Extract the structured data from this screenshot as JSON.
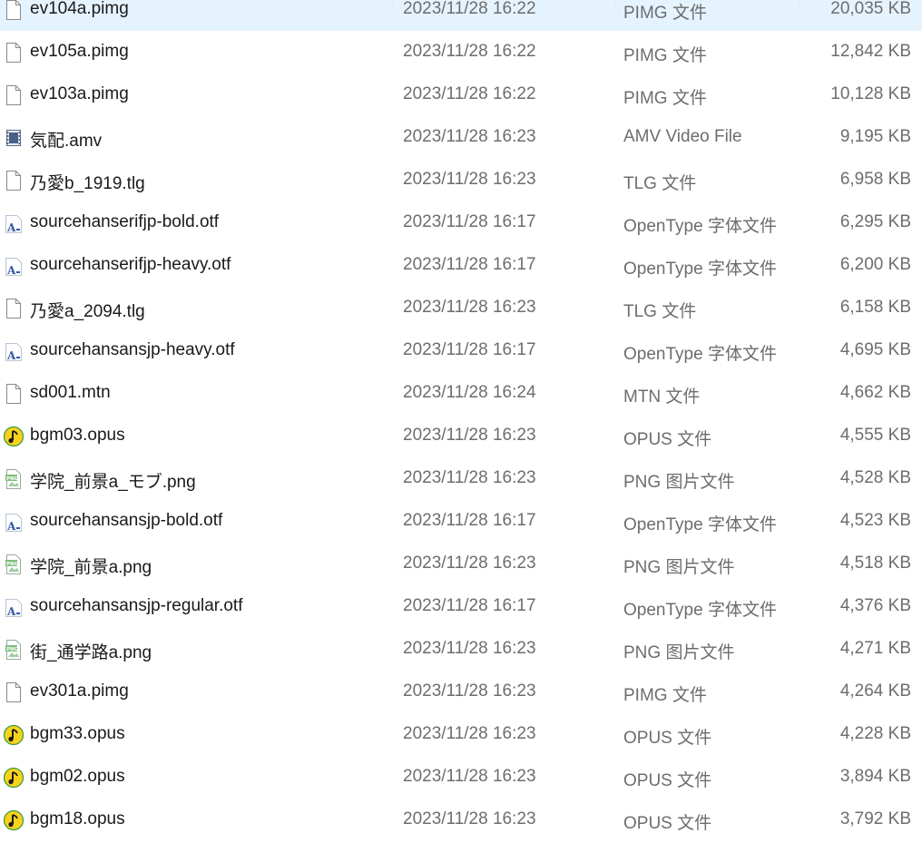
{
  "files": [
    {
      "name": "ev104a.pimg",
      "date": "2023/11/28 16:22",
      "type": "PIMG 文件",
      "size": "20,035 KB",
      "icon": "blank-file-icon"
    },
    {
      "name": "ev105a.pimg",
      "date": "2023/11/28 16:22",
      "type": "PIMG 文件",
      "size": "12,842 KB",
      "icon": "blank-file-icon"
    },
    {
      "name": "ev103a.pimg",
      "date": "2023/11/28 16:22",
      "type": "PIMG 文件",
      "size": "10,128 KB",
      "icon": "blank-file-icon"
    },
    {
      "name": "気配.amv",
      "date": "2023/11/28 16:23",
      "type": "AMV Video File",
      "size": "9,195 KB",
      "icon": "video-file-icon"
    },
    {
      "name": "乃愛b_1919.tlg",
      "date": "2023/11/28 16:23",
      "type": "TLG 文件",
      "size": "6,958 KB",
      "icon": "blank-file-icon"
    },
    {
      "name": "sourcehanserifjp-bold.otf",
      "date": "2023/11/28 16:17",
      "type": "OpenType 字体文件",
      "size": "6,295 KB",
      "icon": "font-file-icon"
    },
    {
      "name": "sourcehanserifjp-heavy.otf",
      "date": "2023/11/28 16:17",
      "type": "OpenType 字体文件",
      "size": "6,200 KB",
      "icon": "font-file-icon"
    },
    {
      "name": "乃愛a_2094.tlg",
      "date": "2023/11/28 16:23",
      "type": "TLG 文件",
      "size": "6,158 KB",
      "icon": "blank-file-icon"
    },
    {
      "name": "sourcehansansjp-heavy.otf",
      "date": "2023/11/28 16:17",
      "type": "OpenType 字体文件",
      "size": "4,695 KB",
      "icon": "font-file-icon"
    },
    {
      "name": "sd001.mtn",
      "date": "2023/11/28 16:24",
      "type": "MTN 文件",
      "size": "4,662 KB",
      "icon": "blank-file-icon"
    },
    {
      "name": "bgm03.opus",
      "date": "2023/11/28 16:23",
      "type": "OPUS 文件",
      "size": "4,555 KB",
      "icon": "music-file-icon"
    },
    {
      "name": "学院_前景a_モブ.png",
      "date": "2023/11/28 16:23",
      "type": "PNG 图片文件",
      "size": "4,528 KB",
      "icon": "image-file-icon"
    },
    {
      "name": "sourcehansansjp-bold.otf",
      "date": "2023/11/28 16:17",
      "type": "OpenType 字体文件",
      "size": "4,523 KB",
      "icon": "font-file-icon"
    },
    {
      "name": "学院_前景a.png",
      "date": "2023/11/28 16:23",
      "type": "PNG 图片文件",
      "size": "4,518 KB",
      "icon": "image-file-icon"
    },
    {
      "name": "sourcehansansjp-regular.otf",
      "date": "2023/11/28 16:17",
      "type": "OpenType 字体文件",
      "size": "4,376 KB",
      "icon": "font-file-icon"
    },
    {
      "name": "街_通学路a.png",
      "date": "2023/11/28 16:23",
      "type": "PNG 图片文件",
      "size": "4,271 KB",
      "icon": "image-file-icon"
    },
    {
      "name": "ev301a.pimg",
      "date": "2023/11/28 16:23",
      "type": "PIMG 文件",
      "size": "4,264 KB",
      "icon": "blank-file-icon"
    },
    {
      "name": "bgm33.opus",
      "date": "2023/11/28 16:23",
      "type": "OPUS 文件",
      "size": "4,228 KB",
      "icon": "music-file-icon"
    },
    {
      "name": "bgm02.opus",
      "date": "2023/11/28 16:23",
      "type": "OPUS 文件",
      "size": "3,894 KB",
      "icon": "music-file-icon"
    },
    {
      "name": "bgm18.opus",
      "date": "2023/11/28 16:23",
      "type": "OPUS 文件",
      "size": "3,792 KB",
      "icon": "music-file-icon"
    }
  ]
}
